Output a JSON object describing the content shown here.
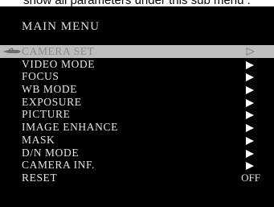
{
  "caption": "show all parameters under this sub menu :",
  "menu": {
    "title": "MAIN MENU",
    "items": [
      {
        "label": "CAMERA SET",
        "indicator": "▷",
        "selected": true
      },
      {
        "label": "VIDEO MODE",
        "indicator": "▶"
      },
      {
        "label": "FOCUS",
        "indicator": "▶"
      },
      {
        "label": "WB MODE",
        "indicator": "▶"
      },
      {
        "label": "EXPOSURE",
        "indicator": "▶"
      },
      {
        "label": "PICTURE",
        "indicator": "▶"
      },
      {
        "label": "IMAGE ENHANCE",
        "indicator": "▶"
      },
      {
        "label": "MASK",
        "indicator": "▶"
      },
      {
        "label": "D/N MODE",
        "indicator": "▶"
      },
      {
        "label": "CAMERA INF.",
        "indicator": "▶"
      },
      {
        "label": "RESET",
        "value": "OFF"
      }
    ]
  },
  "colors": {
    "background": "#000000",
    "text": "#e4e4e4",
    "highlight": "#bdbdbd"
  },
  "icons": {
    "pointer": "pointing-hand-icon",
    "arrow": "triangle-right-icon"
  }
}
